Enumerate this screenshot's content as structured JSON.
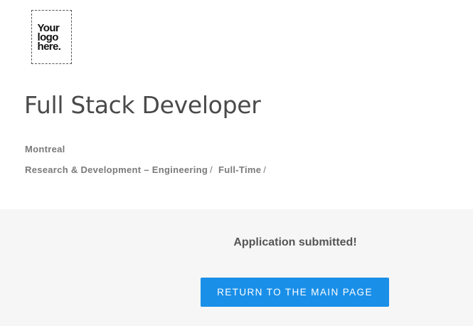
{
  "logo": {
    "lines": [
      "Your",
      "logo",
      "here."
    ]
  },
  "job": {
    "title": "Full Stack Developer",
    "location": "Montreal",
    "categories": [
      "Research & Development – Engineering",
      "Full-Time"
    ],
    "separator": "/"
  },
  "confirmation": {
    "message": "Application submitted!",
    "return_button_label": "RETURN TO THE MAIN PAGE"
  },
  "colors": {
    "button_background": "#1a8fe8",
    "panel_background": "#f6f6f6",
    "title_text": "#4a4a4a",
    "meta_text": "#7a7a7a"
  }
}
